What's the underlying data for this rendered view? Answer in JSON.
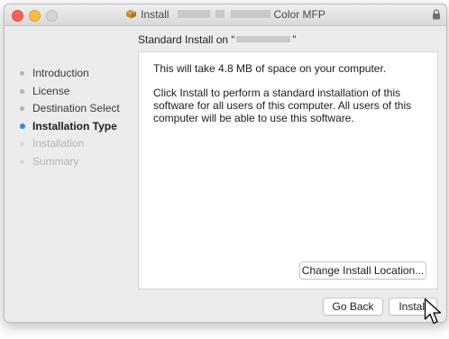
{
  "window": {
    "title_prefix": "Install",
    "title_suffix": "Color MFP"
  },
  "subtitle": {
    "prefix": "Standard Install on “",
    "suffix": "”"
  },
  "sidebar": {
    "items": [
      {
        "label": "Introduction",
        "state": "done"
      },
      {
        "label": "License",
        "state": "done"
      },
      {
        "label": "Destination Select",
        "state": "done"
      },
      {
        "label": "Installation Type",
        "state": "active"
      },
      {
        "label": "Installation",
        "state": "future"
      },
      {
        "label": "Summary",
        "state": "future"
      }
    ]
  },
  "content": {
    "space_text": "This will take 4.8 MB of space on your computer.",
    "description": "Click Install to perform a standard installation of this software for all users of this computer. All users of this computer will be able to use this software.",
    "change_location_label": "Change Install Location..."
  },
  "footer": {
    "go_back_label": "Go Back",
    "install_label": "Install"
  },
  "colors": {
    "active_step_dot": "#3e83de",
    "close": "#fc615d",
    "minimize": "#fdbc40"
  },
  "icons": {
    "title_icon": "package-icon",
    "lock": "lock-icon",
    "pointer": "mouse-pointer-icon"
  }
}
